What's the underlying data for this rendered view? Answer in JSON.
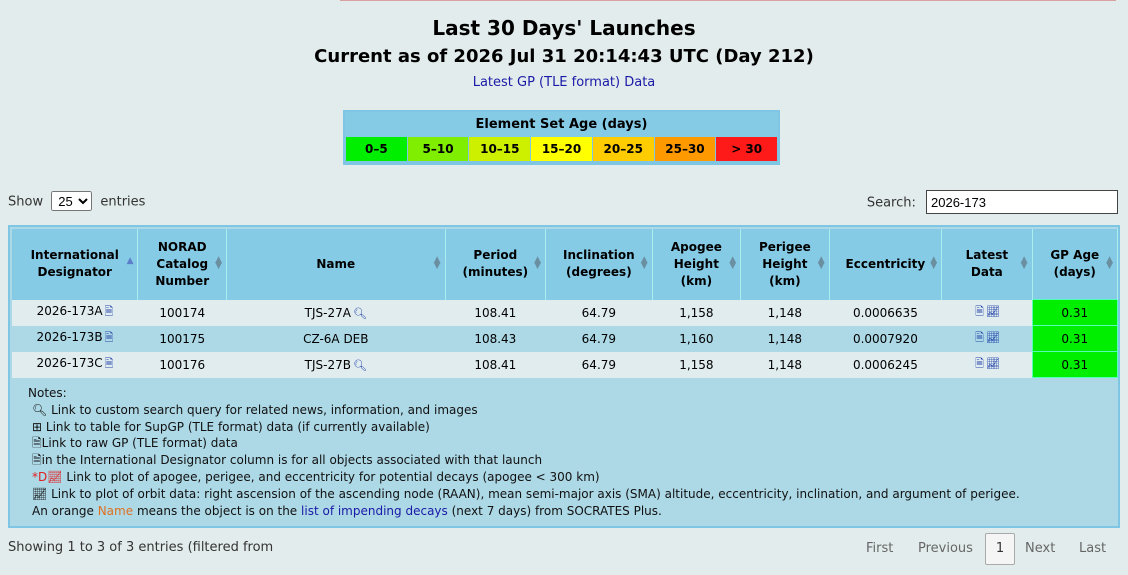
{
  "header": {
    "title": "Last 30 Days' Launches",
    "subtitle": "Current as of 2026 Jul 31 20:14:43 UTC (Day 212)",
    "gp_link": "Latest GP (TLE format) Data"
  },
  "legend": {
    "title": "Element Set Age (days)",
    "bins": [
      {
        "label": "0–5",
        "color": "#00ee00"
      },
      {
        "label": "5–10",
        "color": "#7fee00"
      },
      {
        "label": "10–15",
        "color": "#ccf000"
      },
      {
        "label": "15–20",
        "color": "#ffff00"
      },
      {
        "label": "20–25",
        "color": "#ffcc00"
      },
      {
        "label": "25–30",
        "color": "#ff9900"
      },
      {
        "label": "> 30",
        "color": "#ff1a1a"
      }
    ]
  },
  "controls": {
    "show_prefix": "Show",
    "show_value": "25",
    "show_suffix": "entries",
    "search_label": "Search:",
    "search_value": "2026-173"
  },
  "table": {
    "columns": [
      "International Designator",
      "NORAD Catalog Number",
      "Name",
      "Period (minutes)",
      "Inclination (degrees)",
      "Apogee Height (km)",
      "Perigee Height (km)",
      "Eccentricity",
      "Latest Data",
      "GP Age (days)"
    ],
    "rows": [
      {
        "designator": "2026-173A",
        "norad": "100174",
        "name": "TJS-27A",
        "has_search": true,
        "period": "108.41",
        "inclination": "64.79",
        "apogee": "1,158",
        "perigee": "1,148",
        "eccentricity": "0.0006635",
        "age": "0.31"
      },
      {
        "designator": "2026-173B",
        "norad": "100175",
        "name": "CZ-6A DEB",
        "has_search": false,
        "period": "108.43",
        "inclination": "64.79",
        "apogee": "1,160",
        "perigee": "1,148",
        "eccentricity": "0.0007920",
        "age": "0.31"
      },
      {
        "designator": "2026-173C",
        "norad": "100176",
        "name": "TJS-27B",
        "has_search": true,
        "period": "108.41",
        "inclination": "64.79",
        "apogee": "1,158",
        "perigee": "1,148",
        "eccentricity": "0.0006245",
        "age": "0.31"
      }
    ]
  },
  "notes": {
    "title": "Notes:",
    "search": "Link to custom search query for related news, information, and images",
    "supgp": "Link to table for SupGP (TLE format) data (if currently available)",
    "raw": "Link to raw GP (TLE format) data",
    "designator": "in the International Designator column is for all objects associated with that launch",
    "decay_prefix": "*D",
    "decay": "Link to plot of apogee, perigee, and eccentricity for potential decays (apogee < 300 km)",
    "orbit": "Link to plot of orbit data: right ascension of the ascending node (RAAN), mean semi-major axis (SMA) altitude, eccentricity, inclination, and argument of perigee.",
    "orange_pre": "An orange",
    "orange_word": "Name",
    "orange_mid": "means the object is on the",
    "orange_link": "list of impending decays",
    "orange_post": "(next 7 days) from SOCRATES Plus."
  },
  "footer": {
    "info": "Showing 1 to 3 of 3 entries (filtered from",
    "first": "First",
    "previous": "Previous",
    "current": "1",
    "next": "Next",
    "last": "Last"
  }
}
